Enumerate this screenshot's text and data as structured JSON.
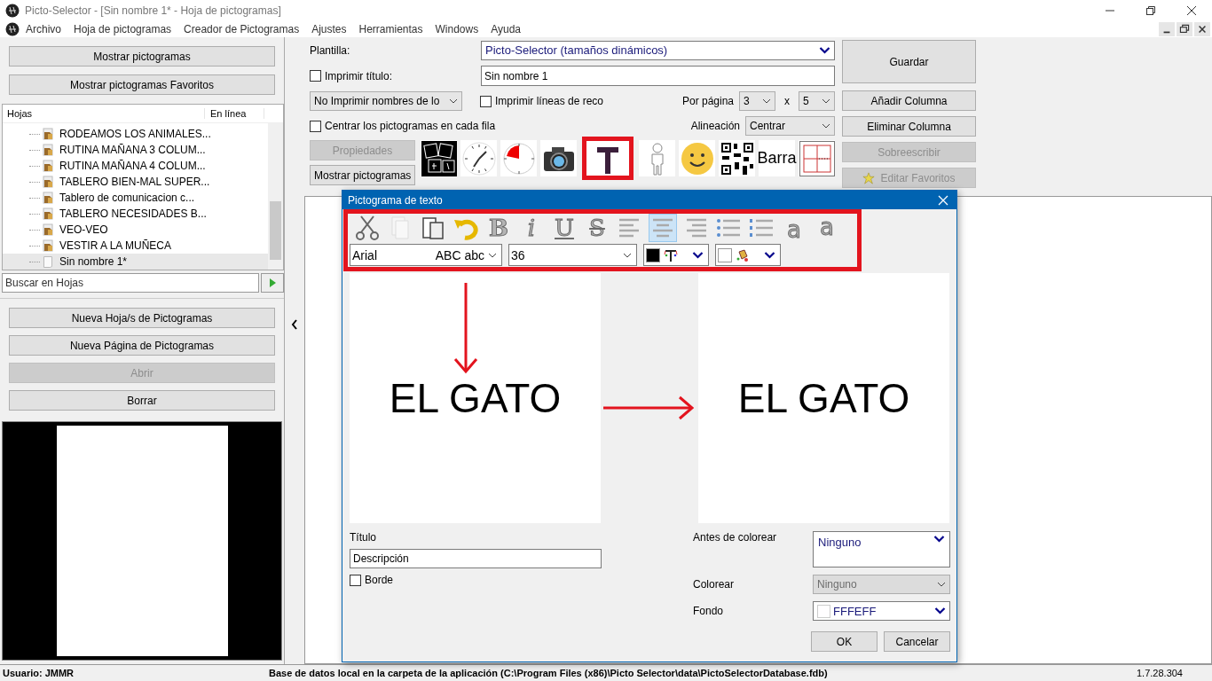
{
  "window": {
    "title": "Picto-Selector - [Sin nombre 1* - Hoja de pictogramas]"
  },
  "menu": [
    "Archivo",
    "Hoja de pictogramas",
    "Creador de Pictogramas",
    "Ajustes",
    "Herramientas",
    "Windows",
    "Ayuda"
  ],
  "left_panel": {
    "top_buttons": [
      {
        "label": "Mostrar pictogramas",
        "disabled": false
      },
      {
        "label": "Mostrar pictogramas Favoritos",
        "disabled": false
      }
    ],
    "tree": {
      "columns": [
        "Hojas",
        "En línea"
      ],
      "items": [
        {
          "label": "RODEAMOS LOS ANIMALES...",
          "kind": "folder",
          "selected": false
        },
        {
          "label": "RUTINA MAÑANA 3 COLUM...",
          "kind": "folder",
          "selected": false
        },
        {
          "label": "RUTINA MAÑANA 4 COLUM...",
          "kind": "folder",
          "selected": false
        },
        {
          "label": "TABLERO BIEN-MAL SUPER...",
          "kind": "folder",
          "selected": false
        },
        {
          "label": "Tablero de comunicacion c...",
          "kind": "folder",
          "selected": false
        },
        {
          "label": "TABLERO NECESIDADES B...",
          "kind": "folder",
          "selected": false
        },
        {
          "label": "VEO-VEO",
          "kind": "folder",
          "selected": false
        },
        {
          "label": "VESTIR A LA MUÑECA",
          "kind": "folder",
          "selected": false
        },
        {
          "label": "Sin nombre 1*",
          "kind": "page",
          "selected": true
        }
      ]
    },
    "search": {
      "placeholder": "Buscar en Hojas"
    },
    "actions": [
      {
        "label": "Nueva Hoja/s de Pictogramas",
        "disabled": false
      },
      {
        "label": "Nueva Página de Pictogramas",
        "disabled": false
      },
      {
        "label": "Abrir",
        "disabled": true
      },
      {
        "label": "Borrar",
        "disabled": false
      }
    ]
  },
  "settings": {
    "plantilla": {
      "label": "Plantilla:",
      "value": "Picto-Selector (tamaños dinámicos)"
    },
    "imprimir_titulo": {
      "label": "Imprimir título:",
      "checked": false,
      "value": "Sin nombre 1"
    },
    "nombres": {
      "value": "No Imprimir nombres de lo"
    },
    "imprimir_lineas": {
      "label": "Imprimir líneas de reco",
      "checked": false
    },
    "centrar": {
      "label": "Centrar los pictogramas en cada fila",
      "checked": false
    },
    "por_pagina": {
      "label": "Por página",
      "rows": "3",
      "separator": "x",
      "cols": "5"
    },
    "alineacion": {
      "label": "Alineación",
      "value": "Centrar"
    },
    "buttons": [
      {
        "label": "Propiedades",
        "disabled": true
      },
      {
        "label": "Mostrar pictogramas",
        "disabled": false
      }
    ],
    "picto_tools": [
      {
        "kind": "photos",
        "highlighted": false
      },
      {
        "kind": "clock",
        "highlighted": false
      },
      {
        "kind": "timer",
        "highlighted": false
      },
      {
        "kind": "camera",
        "highlighted": false
      },
      {
        "kind": "text",
        "highlighted": true
      },
      {
        "kind": "person",
        "highlighted": false
      },
      {
        "kind": "smiley",
        "highlighted": false
      },
      {
        "kind": "qr",
        "highlighted": false
      },
      {
        "kind": "label",
        "label": "Barra",
        "highlighted": false
      },
      {
        "kind": "grid",
        "highlighted": false
      }
    ],
    "side_buttons": [
      {
        "label": "Guardar",
        "kind": "big",
        "disabled": false
      },
      {
        "label": "Añadir Columna",
        "kind": "plain",
        "disabled": false
      },
      {
        "label": "Eliminar Columna",
        "kind": "plain",
        "disabled": false
      },
      {
        "label": "Sobreescribir",
        "kind": "plain",
        "disabled": true
      },
      {
        "label": "Editar Favoritos",
        "kind": "star",
        "disabled": true
      }
    ]
  },
  "dialog": {
    "title": "Pictograma de texto",
    "toolbar_highlighted": true,
    "tools": [
      {
        "kind": "cut",
        "selected": false
      },
      {
        "kind": "copy",
        "selected": false
      },
      {
        "kind": "paste",
        "selected": false
      },
      {
        "kind": "undo",
        "selected": false
      },
      {
        "kind": "bold",
        "glyph": "B",
        "selected": false
      },
      {
        "kind": "italic",
        "glyph": "i",
        "selected": false
      },
      {
        "kind": "underline",
        "glyph": "U",
        "selected": false
      },
      {
        "kind": "strike",
        "glyph": "S",
        "selected": false
      },
      {
        "kind": "align-left",
        "selected": false
      },
      {
        "kind": "align-center",
        "selected": true
      },
      {
        "kind": "align-right",
        "selected": false
      },
      {
        "kind": "bullets",
        "selected": false
      },
      {
        "kind": "numbering",
        "selected": false
      },
      {
        "kind": "superscript",
        "glyph": "a",
        "selected": false
      },
      {
        "kind": "subscript",
        "glyph": "a",
        "selected": false
      }
    ],
    "font": {
      "name": "Arial",
      "sample": "ABC abc"
    },
    "size": "36",
    "color_pickers": [
      {
        "kind": "text",
        "color": "#000000"
      },
      {
        "kind": "fill",
        "color": "#ffffff"
      }
    ],
    "source_text": "EL GATO",
    "preview_text": "EL GATO",
    "titulo": {
      "label": "Título",
      "value": "Descripción"
    },
    "borde": {
      "label": "Borde",
      "checked": false
    },
    "antes": {
      "label": "Antes de colorear",
      "value": "Ninguno"
    },
    "colorear": {
      "label": "Colorear",
      "value": "Ninguno",
      "disabled": true
    },
    "fondo": {
      "label": "Fondo",
      "value": "FFFEFF"
    },
    "buttons": [
      "OK",
      "Cancelar"
    ]
  },
  "status_bar": {
    "user": "Usuario: JMMR",
    "database": "Base de datos local en la carpeta de la aplicación (C:\\Program Files (x86)\\Picto Selector\\data\\PictoSelectorDatabase.fdb)",
    "version": "1.7.28.304"
  }
}
